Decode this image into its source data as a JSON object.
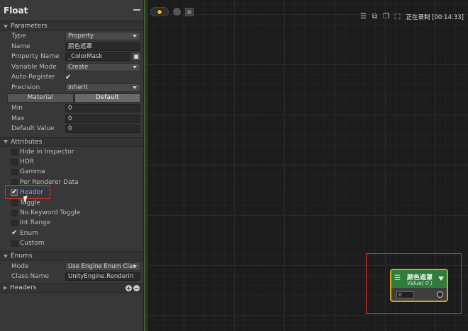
{
  "inspector": {
    "title": "Float",
    "parameters": {
      "header": "Parameters",
      "rows": [
        {
          "label": "Type",
          "value": "Property",
          "kind": "dropdown"
        },
        {
          "label": "Name",
          "value": "颜色遮罩",
          "kind": "text"
        },
        {
          "label": "Property Name",
          "value": "_ColorMask",
          "kind": "text-button"
        },
        {
          "label": "Variable Mode",
          "value": "Create",
          "kind": "dropdown"
        },
        {
          "label": "Auto-Register",
          "value": "✔",
          "kind": "check"
        },
        {
          "label": "Precision",
          "value": "Inherit",
          "kind": "dropdown"
        }
      ],
      "buttons": [
        "Material",
        "Default"
      ],
      "rows2": [
        {
          "label": "Min",
          "value": "0"
        },
        {
          "label": "Max",
          "value": "0"
        },
        {
          "label": "Default Value",
          "value": "0"
        }
      ]
    },
    "attributes": {
      "header": "Attributes",
      "items": [
        {
          "label": "Hide in Inspector",
          "checked": false
        },
        {
          "label": "HDR",
          "checked": false
        },
        {
          "label": "Gamma",
          "checked": false
        },
        {
          "label": "Per Renderer Data",
          "checked": false
        },
        {
          "label": "Header",
          "checked": true,
          "highlight": true
        },
        {
          "label": "Toggle",
          "checked": false
        },
        {
          "label": "No Keyword Toggle",
          "checked": false
        },
        {
          "label": "Int Range",
          "checked": false
        },
        {
          "label": "Enum",
          "checked": true
        },
        {
          "label": "Custom",
          "checked": false
        }
      ]
    },
    "enums": {
      "header": "Enums",
      "rows": [
        {
          "label": "Mode",
          "value": "Use Engine Enum Clas"
        },
        {
          "label": "Class Name",
          "value": "UnityEngine.Renderin"
        }
      ]
    },
    "headers": {
      "header": "Headers"
    }
  },
  "toolbar": {
    "recording": "正在录制 [00:14:33]"
  },
  "node": {
    "title": "颜色遮罩",
    "subtitle": "Value( 0 )",
    "value": "0"
  },
  "colors": {
    "node_header": "#2e7d3a",
    "node_border": "#d4a21e",
    "highlight_box": "#e02a2a",
    "accent_text": "#6aa9f0"
  }
}
